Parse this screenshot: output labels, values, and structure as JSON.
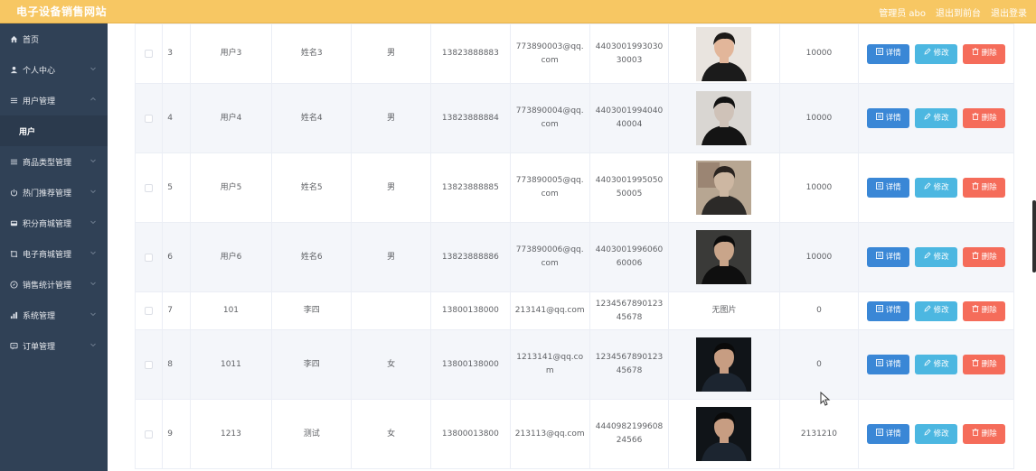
{
  "header": {
    "title": "电子设备销售网站",
    "admin_label": "管理员 abo",
    "back_label": "退出到前台",
    "logout_label": "退出登录"
  },
  "sidebar": {
    "items": [
      {
        "label": "首页",
        "icon": "home-icon",
        "arrow": false
      },
      {
        "label": "个人中心",
        "icon": "user-icon",
        "arrow": "down"
      },
      {
        "label": "用户管理",
        "icon": "menu-icon",
        "arrow": "up"
      },
      {
        "label": "用户",
        "sub": true
      },
      {
        "label": "商品类型管理",
        "icon": "menu-icon",
        "arrow": "down"
      },
      {
        "label": "热门推荐管理",
        "icon": "power-icon",
        "arrow": "down"
      },
      {
        "label": "积分商城管理",
        "icon": "tray-icon",
        "arrow": "down"
      },
      {
        "label": "电子商城管理",
        "icon": "crop-icon",
        "arrow": "down"
      },
      {
        "label": "销售统计管理",
        "icon": "compass-icon",
        "arrow": "down"
      },
      {
        "label": "系统管理",
        "icon": "chart-icon",
        "arrow": "down"
      },
      {
        "label": "订单管理",
        "icon": "message-icon",
        "arrow": "down"
      }
    ]
  },
  "table": {
    "buttons": {
      "detail": "详情",
      "edit": "修改",
      "delete": "删除"
    },
    "rows": [
      {
        "index": "3",
        "account": "用户3",
        "name": "姓名3",
        "gender": "男",
        "phone": "13823888883",
        "email": "773890003@qq.com",
        "idcard": "440300199303030003",
        "photo": "p1",
        "points": "10000"
      },
      {
        "index": "4",
        "account": "用户4",
        "name": "姓名4",
        "gender": "男",
        "phone": "13823888884",
        "email": "773890004@qq.com",
        "idcard": "440300199404040004",
        "photo": "p2",
        "points": "10000"
      },
      {
        "index": "5",
        "account": "用户5",
        "name": "姓名5",
        "gender": "男",
        "phone": "13823888885",
        "email": "773890005@qq.com",
        "idcard": "440300199505050005",
        "photo": "p3",
        "points": "10000"
      },
      {
        "index": "6",
        "account": "用户6",
        "name": "姓名6",
        "gender": "男",
        "phone": "13823888886",
        "email": "773890006@qq.com",
        "idcard": "440300199606060006",
        "photo": "p4",
        "points": "10000"
      },
      {
        "index": "7",
        "account": "101",
        "name": "李四",
        "gender": "",
        "phone": "13800138000",
        "email": "213141@qq.com",
        "idcard": "123456789012345678",
        "photo_text": "无图片",
        "points": "0"
      },
      {
        "index": "8",
        "account": "1011",
        "name": "李四",
        "gender": "女",
        "phone": "13800138000",
        "email": "1213141@qq.com",
        "idcard": "123456789012345678",
        "photo": "p5",
        "points": "0"
      },
      {
        "index": "9",
        "account": "1213",
        "name": "测试",
        "gender": "女",
        "phone": "13800013800",
        "email": "213113@qq.com",
        "idcard": "444098219960824566",
        "photo": "p5",
        "points": "2131210"
      }
    ]
  }
}
